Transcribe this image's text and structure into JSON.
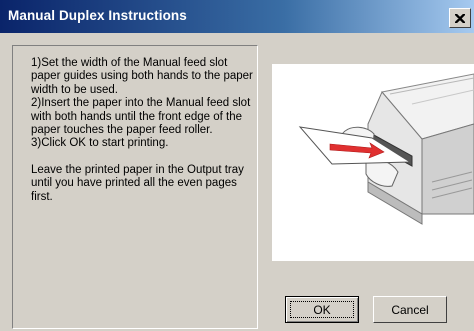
{
  "window": {
    "title": "Manual Duplex Instructions",
    "close_icon": "close-icon"
  },
  "instructions": {
    "step1": "1)Set the width of the Manual feed slot paper guides using both hands to the paper width to be used.",
    "step2": "2)Insert the paper into the Manual feed slot with both hands until the front edge of the paper touches the paper feed roller.",
    "step3": "3)Click OK to start printing.",
    "note": "Leave the printed paper in the Output tray until you have printed all the even pages first."
  },
  "illustration": {
    "icon": "printer-manual-feed-illustration",
    "arrow_color": "#e03030"
  },
  "buttons": {
    "ok_label": "OK",
    "cancel_label": "Cancel"
  },
  "colors": {
    "title_bar_start": "#0a246a",
    "title_bar_end": "#a6caf0",
    "dialog_face": "#d4d0c8"
  }
}
